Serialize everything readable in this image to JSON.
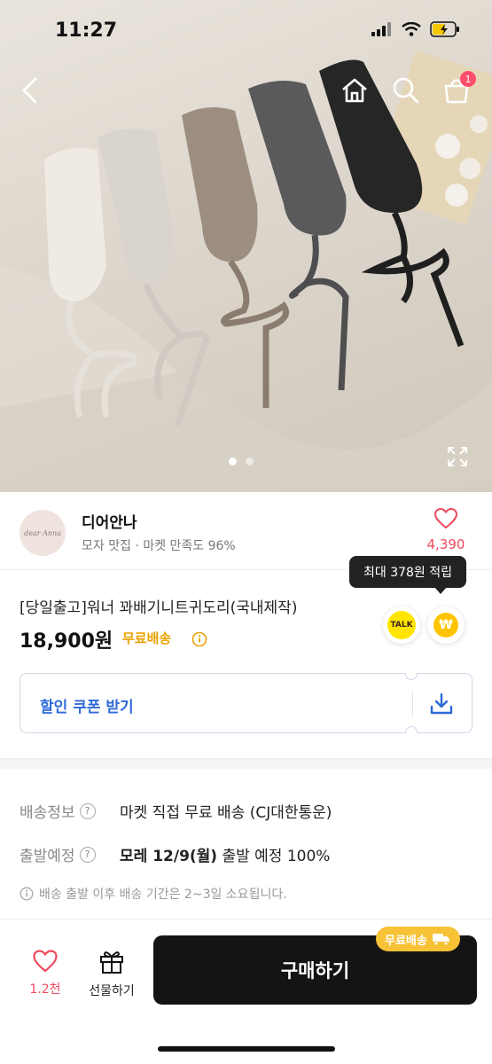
{
  "status_bar": {
    "time": "11:27"
  },
  "nav": {
    "cart_count": "1"
  },
  "hero": {
    "total_slides": 2,
    "active_slide": 1
  },
  "seller": {
    "avatar_text": "dear Anna",
    "name": "디어안나",
    "meta": "모자 맛집 · 마켓 만족도 96%",
    "likes": "4,390"
  },
  "product": {
    "points_tooltip": "최대 378원 적립",
    "title": "[당일출고]워너 꽈배기니트귀도리(국내제작)",
    "price": "18,900원",
    "free_shipping": "무료배송",
    "talk_label": "TALK",
    "point_symbol": "₩"
  },
  "coupon": {
    "label": "할인 쿠폰 받기"
  },
  "shipping": {
    "info_label": "배송정보",
    "info_value": "마켓 직접 무료 배송 (CJ대한통운)",
    "depart_label": "출발예정",
    "depart_date": "모레 12/9(월)",
    "depart_rest": " 출발 예정 100%",
    "note": "배송 출발 이후 배송 기간은 2~3일 소요됩니다."
  },
  "bottom_bar": {
    "like_count": "1.2천",
    "gift_label": "선물하기",
    "buy_label": "구매하기",
    "free_badge": "무료배송"
  },
  "colors": {
    "accent_blue": "#2f6bd8",
    "free_ship_yellow": "#e9a300",
    "like_red": "#ef4a5e",
    "buy_button": "#141414"
  }
}
